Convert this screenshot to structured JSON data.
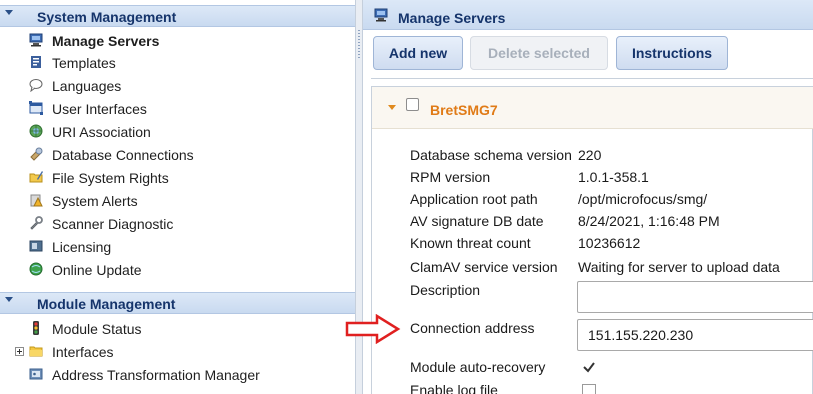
{
  "left_panel": {
    "system_management": {
      "title": "System Management",
      "items": [
        {
          "label": "Manage Servers",
          "icon": "computer-icon",
          "selected": true
        },
        {
          "label": "Templates",
          "icon": "document-icon"
        },
        {
          "label": "Languages",
          "icon": "speech-bubble-icon"
        },
        {
          "label": "User Interfaces",
          "icon": "window-icon"
        },
        {
          "label": "URI Association",
          "icon": "globe-icon"
        },
        {
          "label": "Database Connections",
          "icon": "database-plug-icon"
        },
        {
          "label": "File System Rights",
          "icon": "folder-pen-icon"
        },
        {
          "label": "System Alerts",
          "icon": "alert-icon"
        },
        {
          "label": "Scanner Diagnostic",
          "icon": "wrench-icon"
        },
        {
          "label": "Licensing",
          "icon": "license-icon"
        },
        {
          "label": "Online Update",
          "icon": "globe-green-icon"
        }
      ]
    },
    "module_management": {
      "title": "Module Management",
      "items": [
        {
          "label": "Module Status",
          "icon": "traffic-light-icon"
        },
        {
          "label": "Interfaces",
          "icon": "folder-icon",
          "expandable": true
        },
        {
          "label": "Address Transformation Manager",
          "icon": "address-card-icon"
        }
      ]
    }
  },
  "right_panel": {
    "title": "Manage Servers",
    "toolbar": {
      "add_new": "Add new",
      "delete_selected": "Delete selected",
      "instructions": "Instructions"
    },
    "server": {
      "name": "BretSMG7",
      "details": [
        {
          "key": "Database schema version",
          "value": "220"
        },
        {
          "key": "RPM version",
          "value": "1.0.1-358.1"
        },
        {
          "key": "Application root path",
          "value": "/opt/microfocus/smg/"
        },
        {
          "key": "AV signature DB date",
          "value": "8/24/2021, 1:16:48 PM"
        },
        {
          "key": "Known threat count",
          "value": "10236612"
        },
        {
          "key": "ClamAV service version",
          "value": "Waiting for server to upload data"
        }
      ],
      "description_label": "Description",
      "description_value": "",
      "connection_label": "Connection address",
      "connection_value": "151.155.220.230",
      "auto_recovery_label": "Module auto-recovery",
      "auto_recovery_checked": true,
      "log_file_label": "Enable log file"
    }
  },
  "colors": {
    "header_text": "#15346b",
    "server_name": "#e07b17",
    "annotation_arrow": "#e02020"
  }
}
